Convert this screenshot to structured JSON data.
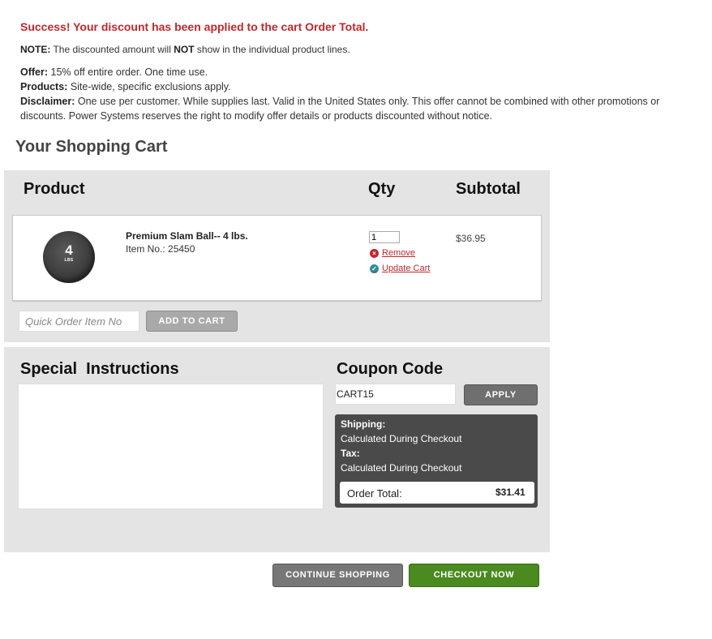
{
  "messages": {
    "success": "Success! Your discount has been applied to the cart Order Total.",
    "note_label": "NOTE:",
    "note_text_1": " The discounted amount will ",
    "note_not": "NOT",
    "note_text_2": " show in the individual product lines."
  },
  "offer": {
    "offer_label": "Offer:",
    "offer_text": " 15% off entire order. One time use.",
    "products_label": "Products:",
    "products_text": " Site-wide, specific exclusions apply.",
    "disclaimer_label": "Disclaimer:",
    "disclaimer_text": " One use per customer. While supplies last. Valid in the United States only. This offer cannot be combined with other promotions or discounts. Power Systems reserves the right to modify offer details or products discounted without notice."
  },
  "cart": {
    "title": "Your Shopping Cart",
    "headers": {
      "product": "Product",
      "qty": "Qty",
      "subtotal": "Subtotal"
    },
    "items": [
      {
        "name": "Premium Slam Ball-- 4 lbs.",
        "item_no": "Item No.: 25450",
        "image_number": "4",
        "image_unit": "LBS",
        "qty": "1",
        "remove_label": "Remove",
        "update_label": "Update Cart",
        "subtotal": "$36.95"
      }
    ],
    "quick_order_placeholder": "Quick Order Item No",
    "add_to_cart_label": "ADD TO CART"
  },
  "special": {
    "title": "Special  Instructions",
    "value": ""
  },
  "coupon": {
    "title": "Coupon Code",
    "value": "CART15",
    "apply_label": "APPLY"
  },
  "summary": {
    "shipping_label": "Shipping:",
    "shipping_value": "Calculated During Checkout",
    "tax_label": "Tax:",
    "tax_value": "Calculated During Checkout",
    "order_total_label": "Order Total:",
    "order_total_value": "$31.41"
  },
  "actions": {
    "continue_label": "CONTINUE SHOPPING",
    "checkout_label": "CHECKOUT NOW"
  },
  "colors": {
    "accent_red": "#c1272d",
    "checkout_green": "#4a8a1f",
    "panel_gray": "#e5e4e4",
    "summary_dark": "#4a4a4a"
  },
  "icons": {
    "remove": "remove-x-circle-icon",
    "update": "update-check-circle-icon"
  }
}
